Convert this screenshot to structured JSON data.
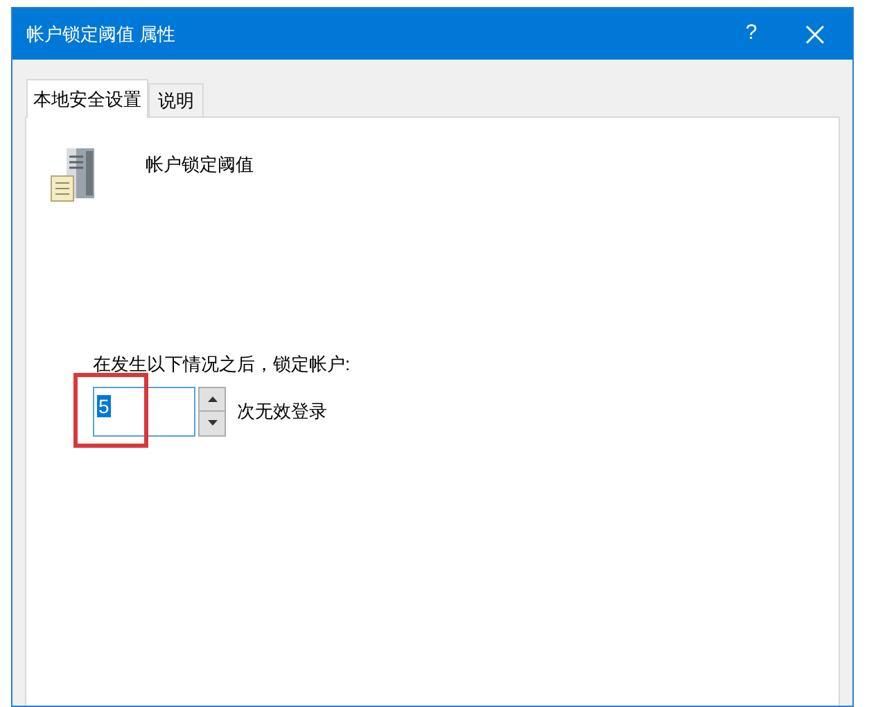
{
  "window": {
    "title": "帐户锁定阈值 属性",
    "help": "?"
  },
  "tabs": [
    {
      "label": "本地安全设置",
      "selected": true
    },
    {
      "label": "说明",
      "selected": false
    }
  ],
  "policy": {
    "name": "帐户锁定阈值"
  },
  "lockout": {
    "label": "在发生以下情况之后，锁定帐户:",
    "value": "5",
    "value_selected": true,
    "suffix": "次无效登录",
    "highlighted": true
  }
}
